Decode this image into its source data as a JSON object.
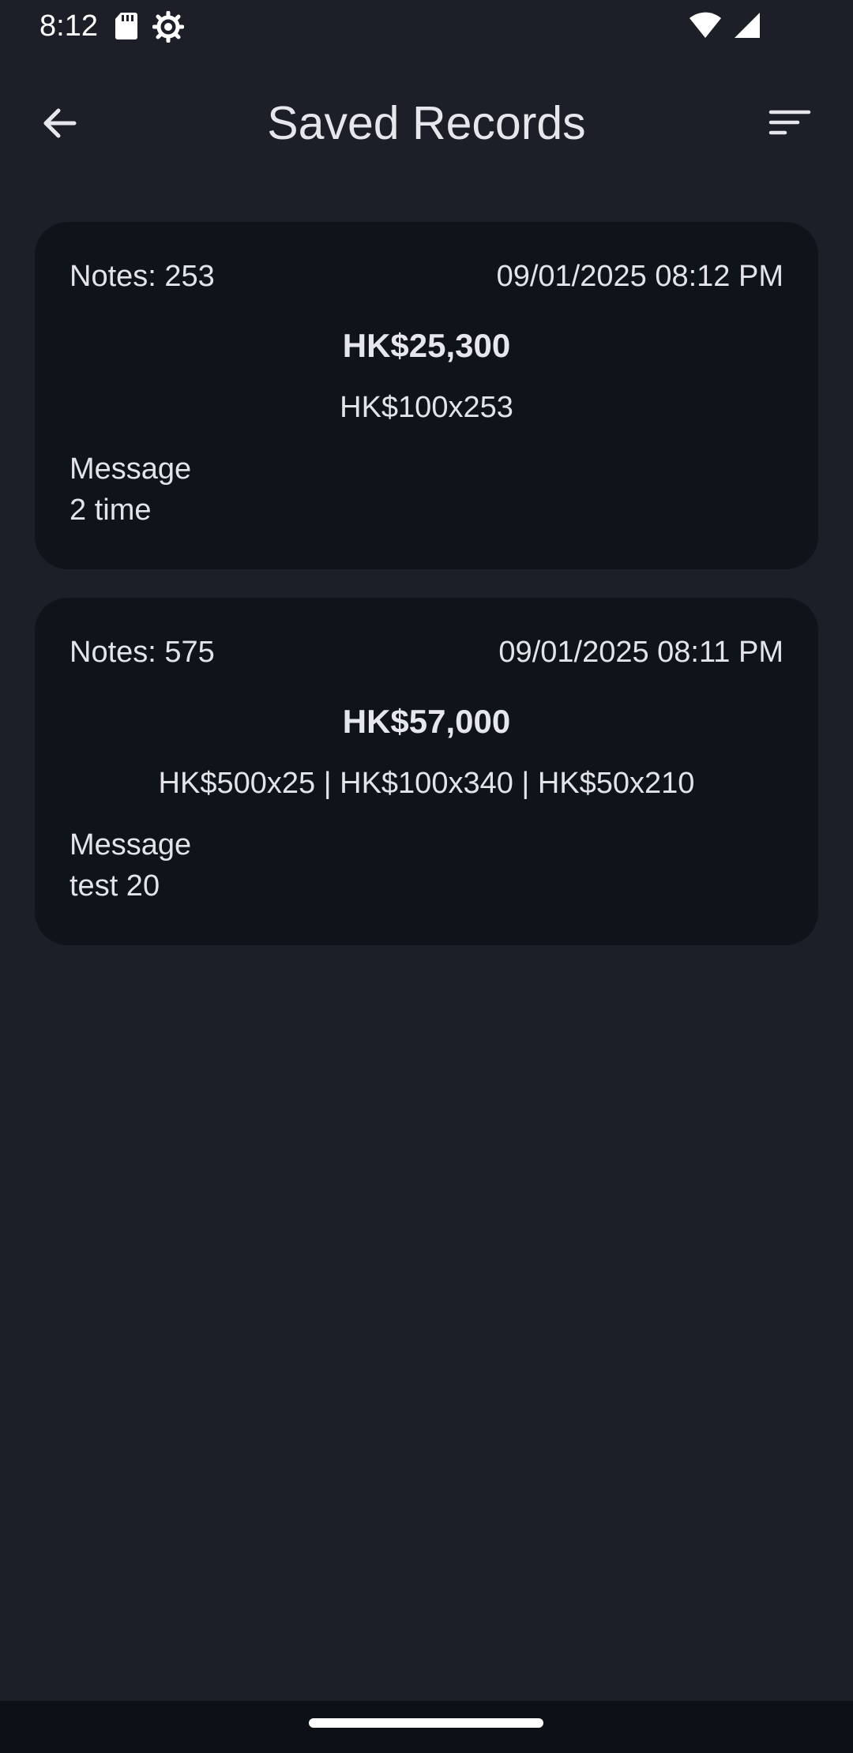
{
  "status_bar": {
    "time": "8:12",
    "left_icons": [
      "sd-card-icon",
      "settings-gear-icon"
    ],
    "right_icons": [
      "wifi-icon",
      "cell-signal-icon"
    ]
  },
  "app_bar": {
    "title": "Saved Records",
    "back_icon": "arrow-left-icon",
    "sort_icon": "sort-icon"
  },
  "records": [
    {
      "notes": "Notes: 253",
      "datetime": "09/01/2025 08:12 PM",
      "total": "HK$25,300",
      "breakdown": "HK$100x253",
      "message_label": "Message",
      "message": "2 time"
    },
    {
      "notes": "Notes: 575",
      "datetime": "09/01/2025 08:11 PM",
      "total": "HK$57,000",
      "breakdown": "HK$500x25 | HK$100x340 | HK$50x210",
      "message_label": "Message",
      "message": "test 20"
    }
  ],
  "colors": {
    "background": "#1c1f27",
    "card": "#0f131a",
    "text": "#e3e4e8"
  }
}
